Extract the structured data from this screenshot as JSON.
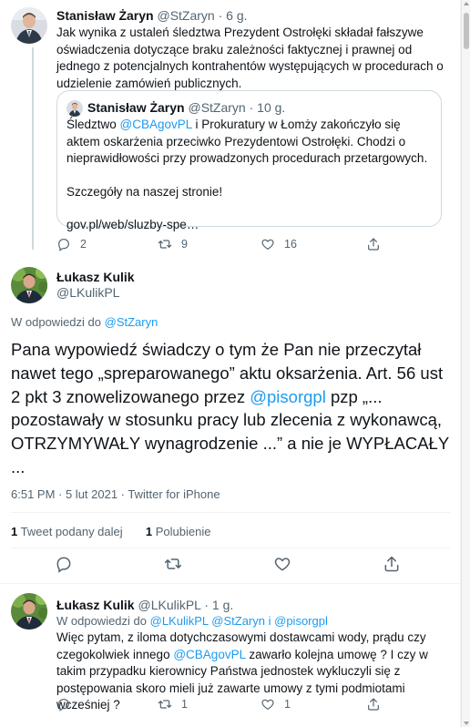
{
  "tweet1": {
    "name": "Stanisław Żaryn",
    "handle": "@StZaryn",
    "time": "6 g.",
    "text": "Jak wynika z ustaleń śledztwa Prezydent Ostrołęki składał fałszywe oświadczenia dotyczące braku zależności faktycznej i prawnej od jednego z potencjalnych kontrahentów występujących w procedurach o udzielenie zamówień publicznych.",
    "replies": "2",
    "retweets": "9",
    "likes": "16"
  },
  "quote": {
    "name": "Stanisław Żaryn",
    "handle": "@StZaryn",
    "time": "10 g.",
    "text_pre": "Śledztwo ",
    "mention": "@CBAgovPL",
    "text_post": " i Prokuratury w Łomży zakończyło się aktem oskarżenia przeciwko Prezydentowi Ostrołęki. Chodzi o nieprawidłowości przy prowadzonych procedurach przetargowych.",
    "text2": "Szczegóły na naszej stronie!",
    "link": "gov.pl/web/sluzby-spe…"
  },
  "tweet2": {
    "name": "Łukasz Kulik",
    "handle": "@LKulikPL",
    "replying_label": "W odpowiedzi do ",
    "replying_to": "@StZaryn",
    "text_pre": "Pana wypowiedź świadczy o tym że Pan nie przeczytał nawet tego „spreparowanego” aktu oksarżenia. Art. 56 ust 2 pkt 3 znowelizowanego przez ",
    "mention": "@pisorgpl",
    "text_post": " pzp „... pozostawały w stosunku pracy lub zlecenia z wykonawcą, OTRZYMYWAŁY wynagrodzenie ...” a nie je WYPŁACAŁY ...",
    "meta": "6:51 PM · 5 lut 2021 · Twitter for iPhone",
    "retweet_count": "1",
    "retweet_label": "Tweet podany dalej",
    "like_count": "1",
    "like_label": "Polubienie"
  },
  "tweet3": {
    "name": "Łukasz Kulik",
    "handle": "@LKulikPL",
    "time": "1 g.",
    "reply_label": "W odpowiedzi do ",
    "reply_to1": "@LKulikPL",
    "reply_to2": "@StZaryn",
    "reply_and": " i ",
    "reply_to3": "@pisorgpl",
    "text_pre": "Więc pytam, z iloma dotychczasowymi dostawcami wody, prądu czy czegokolwiek innego ",
    "mention": "@CBAgovPL",
    "text_post": "  zawarło kolejna umowę ? I czy w takim przypadku kierownicy Państwa jednostek wykluczyli się z postępowania skoro mieli już zawarte umowy z tymi podmiotami wcześniej ?",
    "replies": "",
    "retweets": "1",
    "likes": "1"
  },
  "colors": {
    "accent": "#1d9bf0",
    "text": "#0f1419",
    "secondary": "#536471",
    "border": "#cfd9de"
  },
  "icons": [
    "reply-icon",
    "retweet-icon",
    "like-icon",
    "share-icon"
  ]
}
